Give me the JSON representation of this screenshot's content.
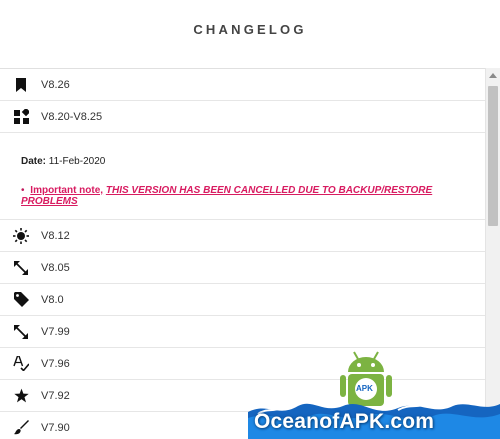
{
  "header": {
    "title": "CHANGELOG"
  },
  "versions": [
    {
      "label": "V8.26",
      "icon": "bookmark-icon"
    },
    {
      "label": "V8.20-V8.25",
      "icon": "widgets-icon"
    }
  ],
  "expanded": {
    "date_key": "Date:",
    "date_value": "11-Feb-2020",
    "bullet": "•",
    "note_link": "Important note,",
    "note_text": "THIS VERSION HAS BEEN CANCELLED DUE TO BACKUP/RESTORE PROBLEMS"
  },
  "versions_after": [
    {
      "label": "V8.12",
      "icon": "brightness-icon"
    },
    {
      "label": "V8.05",
      "icon": "expand-diagonal-icon"
    },
    {
      "label": "V8.0",
      "icon": "tag-icon"
    },
    {
      "label": "V7.99",
      "icon": "expand-diagonal-icon"
    },
    {
      "label": "V7.96",
      "icon": "spellcheck-icon"
    },
    {
      "label": "V7.92",
      "icon": "star-icon"
    },
    {
      "label": "V7.90",
      "icon": "brush-icon"
    }
  ],
  "watermark": {
    "text": "OceanofAPK.com",
    "badge": "APK"
  },
  "colors": {
    "accent": "#d81b60",
    "text": "#333333",
    "divider": "#e6e6e6"
  }
}
